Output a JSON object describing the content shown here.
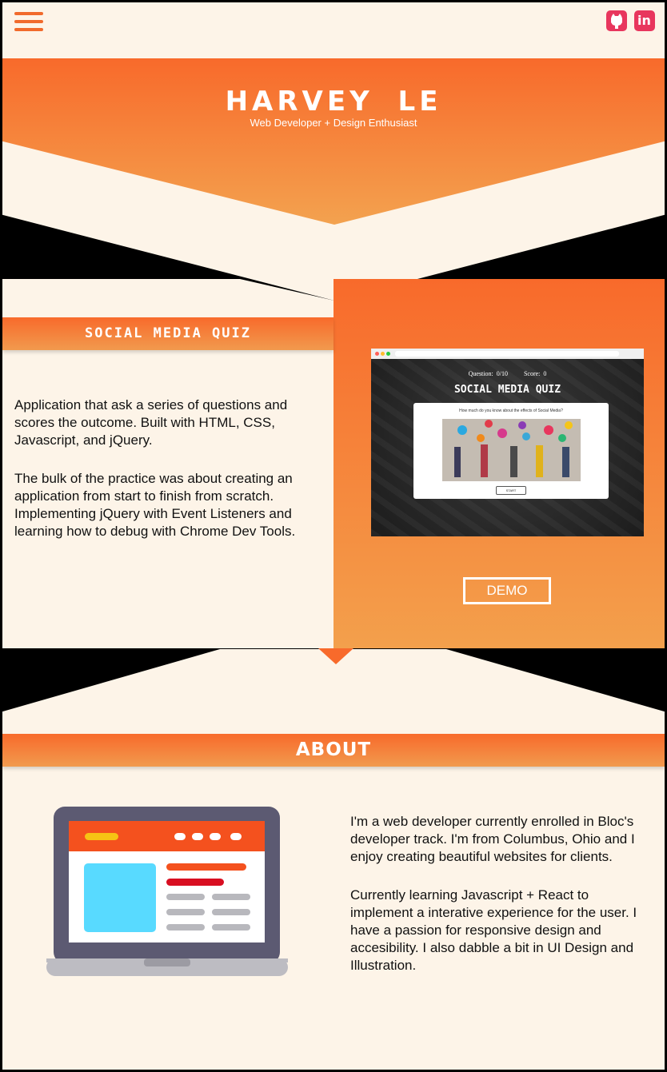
{
  "nav": {
    "menu_icon": "hamburger-icon",
    "social": [
      {
        "name": "GitHub",
        "icon": "github-icon"
      },
      {
        "name": "LinkedIn",
        "icon": "linkedin-icon",
        "glyph": "in"
      }
    ]
  },
  "hero": {
    "name": "HARVEY LE",
    "tagline": "Web Developer + Design Enthusiast"
  },
  "project": {
    "title": "SOCIAL MEDIA QUIZ",
    "description_1": "Application that ask a series of questions and scores the outcome. Built with HTML, CSS, Javascript, and jQuery.",
    "description_2": "The bulk of the practice was about creating an application from start to finish from scratch. Implementing jQuery with Event Listeners and learning how to debug with Chrome Dev Tools.",
    "demo_label": "DEMO",
    "preview": {
      "question_counter": "Question: 0/10",
      "score": "Score: 0",
      "title": "SOCIAL MEDIA QUIZ",
      "question": "How much do you know about the effects of Social Media?",
      "start_label": "START"
    }
  },
  "about": {
    "title": "ABOUT",
    "paragraph_1": "I'm a web developer currently enrolled in Bloc's developer track. I'm from Columbus, Ohio and I enjoy creating beautiful websites for clients.",
    "paragraph_2": "Currently learning Javascript + React to implement a interative experience for the user. I have a passion for responsive design and accesibility. I also dabble a bit in UI Design and Illustration.",
    "illustration": "laptop-illustration"
  },
  "colors": {
    "accent": "#f86a2b",
    "accent_light": "#f3a04c",
    "social": "#e8365d",
    "background": "#fdf4e8",
    "frame": "#000000"
  }
}
